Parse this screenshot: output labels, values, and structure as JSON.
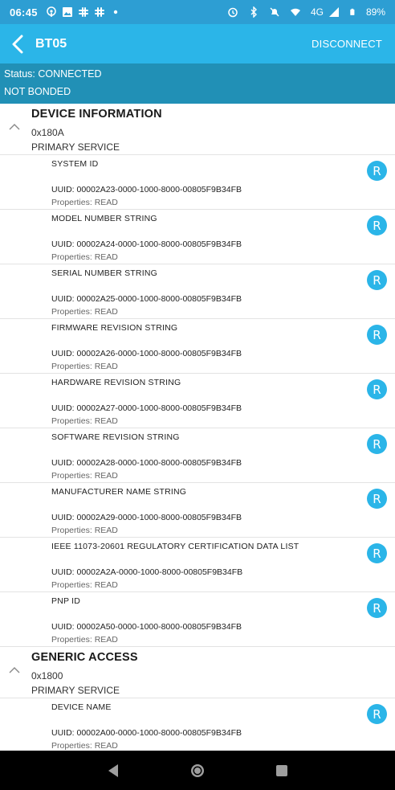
{
  "statusbar": {
    "time": "06:45",
    "network": "4G",
    "battery": "89%",
    "left_icons": [
      "podcast-icon",
      "image-icon",
      "slack-icon",
      "slack-icon",
      "dot-icon"
    ],
    "right_icons": [
      "alarm-icon",
      "bluetooth-icon",
      "mute-icon",
      "wifi-icon",
      "signal-icon",
      "battery-icon"
    ]
  },
  "appbar": {
    "title": "BT05",
    "disconnect_label": "DISCONNECT",
    "background": "#2bb5e8"
  },
  "info": {
    "status": "Status: CONNECTED",
    "bond": "NOT BONDED"
  },
  "services": [
    {
      "name": "DEVICE INFORMATION",
      "uuid": "0x180A",
      "type": "PRIMARY SERVICE",
      "characteristics": [
        {
          "name": "SYSTEM ID",
          "uuid": "UUID: 00002A23-0000-1000-8000-00805F9B34FB",
          "props": "Properties: READ",
          "badge": "R"
        },
        {
          "name": "MODEL NUMBER STRING",
          "uuid": "UUID: 00002A24-0000-1000-8000-00805F9B34FB",
          "props": "Properties: READ",
          "badge": "R"
        },
        {
          "name": "SERIAL NUMBER STRING",
          "uuid": "UUID: 00002A25-0000-1000-8000-00805F9B34FB",
          "props": "Properties: READ",
          "badge": "R"
        },
        {
          "name": "FIRMWARE REVISION STRING",
          "uuid": "UUID: 00002A26-0000-1000-8000-00805F9B34FB",
          "props": "Properties: READ",
          "badge": "R"
        },
        {
          "name": "HARDWARE REVISION STRING",
          "uuid": "UUID: 00002A27-0000-1000-8000-00805F9B34FB",
          "props": "Properties: READ",
          "badge": "R"
        },
        {
          "name": "SOFTWARE REVISION STRING",
          "uuid": "UUID: 00002A28-0000-1000-8000-00805F9B34FB",
          "props": "Properties: READ",
          "badge": "R"
        },
        {
          "name": "MANUFACTURER NAME STRING",
          "uuid": "UUID: 00002A29-0000-1000-8000-00805F9B34FB",
          "props": "Properties: READ",
          "badge": "R"
        },
        {
          "name": "IEEE 11073-20601 REGULATORY CERTIFICATION DATA LIST",
          "uuid": "UUID: 00002A2A-0000-1000-8000-00805F9B34FB",
          "props": "Properties: READ",
          "badge": "R"
        },
        {
          "name": "PNP ID",
          "uuid": "UUID: 00002A50-0000-1000-8000-00805F9B34FB",
          "props": "Properties: READ",
          "badge": "R"
        }
      ]
    },
    {
      "name": "GENERIC ACCESS",
      "uuid": "0x1800",
      "type": "PRIMARY SERVICE",
      "characteristics": [
        {
          "name": "DEVICE NAME",
          "uuid": "UUID: 00002A00-0000-1000-8000-00805F9B34FB",
          "props": "Properties: READ",
          "badge": "R"
        }
      ]
    }
  ]
}
